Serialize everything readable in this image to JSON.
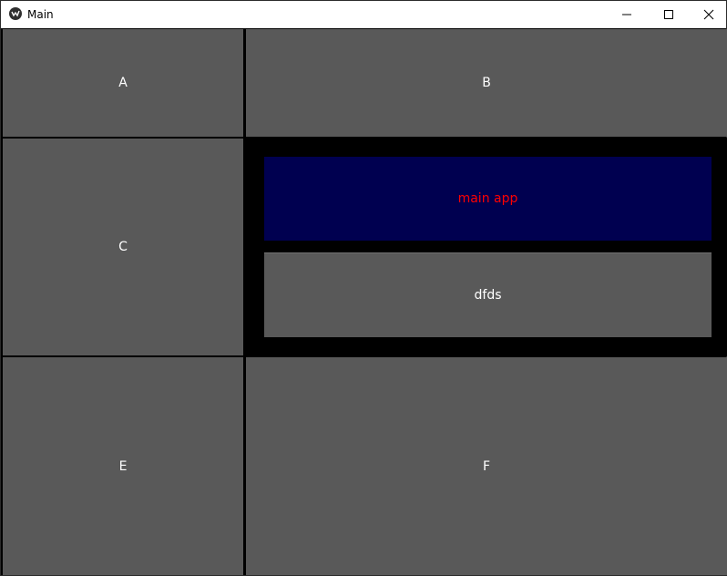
{
  "window": {
    "title": "Main",
    "icon": "app-logo-icon",
    "controls": {
      "minimize_icon": "minimize-icon",
      "maximize_icon": "maximize-icon",
      "close_icon": "close-icon"
    }
  },
  "grid": {
    "a_label": "A",
    "b_label": "B",
    "c_label": "C",
    "e_label": "E",
    "f_label": "F"
  },
  "center": {
    "title": "main app",
    "button_label": "dfds"
  },
  "colors": {
    "cell_bg": "#595959",
    "panel_bg": "#000000",
    "title_bg": "#000050",
    "title_text": "#ff0000",
    "cell_text": "#ffffff"
  }
}
